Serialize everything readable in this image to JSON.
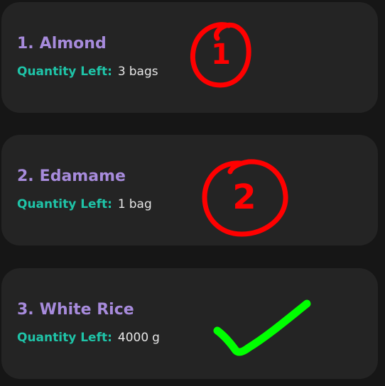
{
  "items": [
    {
      "number": "1.",
      "name": "Almond",
      "quantity_label": "Quantity Left:",
      "quantity": "3",
      "unit": "bags"
    },
    {
      "number": "2.",
      "name": "Edamame",
      "quantity_label": "Quantity Left:",
      "quantity": "1",
      "unit": "bag"
    },
    {
      "number": "3.",
      "name": "White Rice",
      "quantity_label": "Quantity Left:",
      "quantity": "4000",
      "unit": "g"
    }
  ],
  "annotations": [
    {
      "text": "1",
      "color": "#ff0000",
      "icon": "circled-number"
    },
    {
      "text": "2",
      "color": "#ff0000",
      "icon": "circled-number"
    },
    {
      "icon": "checkmark-icon",
      "color": "#00ff00"
    }
  ]
}
